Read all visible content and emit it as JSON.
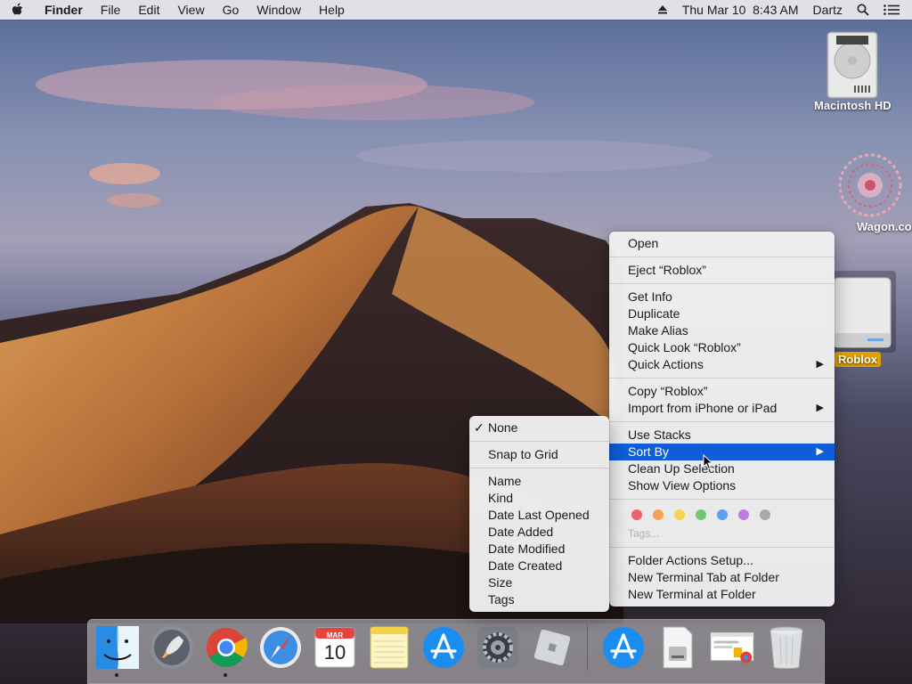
{
  "menubar": {
    "app": "Finder",
    "items": [
      "File",
      "Edit",
      "View",
      "Go",
      "Window",
      "Help"
    ],
    "clock": "Thu Mar 10  8:43 AM",
    "user": "Dartz"
  },
  "desktop_icons": {
    "hd_label": "Macintosh HD",
    "wagon_label": "Wagon.com",
    "roblox_label": "Roblox"
  },
  "context_menu": {
    "open": "Open",
    "eject": "Eject “Roblox”",
    "get_info": "Get Info",
    "duplicate": "Duplicate",
    "make_alias": "Make Alias",
    "quick_look": "Quick Look “Roblox”",
    "quick_actions": "Quick Actions",
    "copy": "Copy “Roblox”",
    "import": "Import from iPhone or iPad",
    "use_stacks": "Use Stacks",
    "sort_by": "Sort By",
    "clean_up": "Clean Up Selection",
    "view_options": "Show View Options",
    "tags_label": "Tags...",
    "folder_actions": "Folder Actions Setup...",
    "new_terminal_tab": "New Terminal Tab at Folder",
    "new_terminal": "New Terminal at Folder",
    "tag_colors": [
      "#f0616f",
      "#f6a24e",
      "#f5d34d",
      "#6ccb6e",
      "#58a0f4",
      "#c07ce6",
      "#a8a8a8"
    ]
  },
  "sort_submenu": {
    "none": "None",
    "snap": "Snap to Grid",
    "name": "Name",
    "kind": "Kind",
    "last_opened": "Date Last Opened",
    "added": "Date Added",
    "modified": "Date Modified",
    "created": "Date Created",
    "size": "Size",
    "tags": "Tags"
  },
  "dock": {
    "calendar_month": "MAR",
    "calendar_day": "10"
  },
  "colors": {
    "highlight": "#0f5dd8",
    "selection_label": "#e3a100"
  }
}
